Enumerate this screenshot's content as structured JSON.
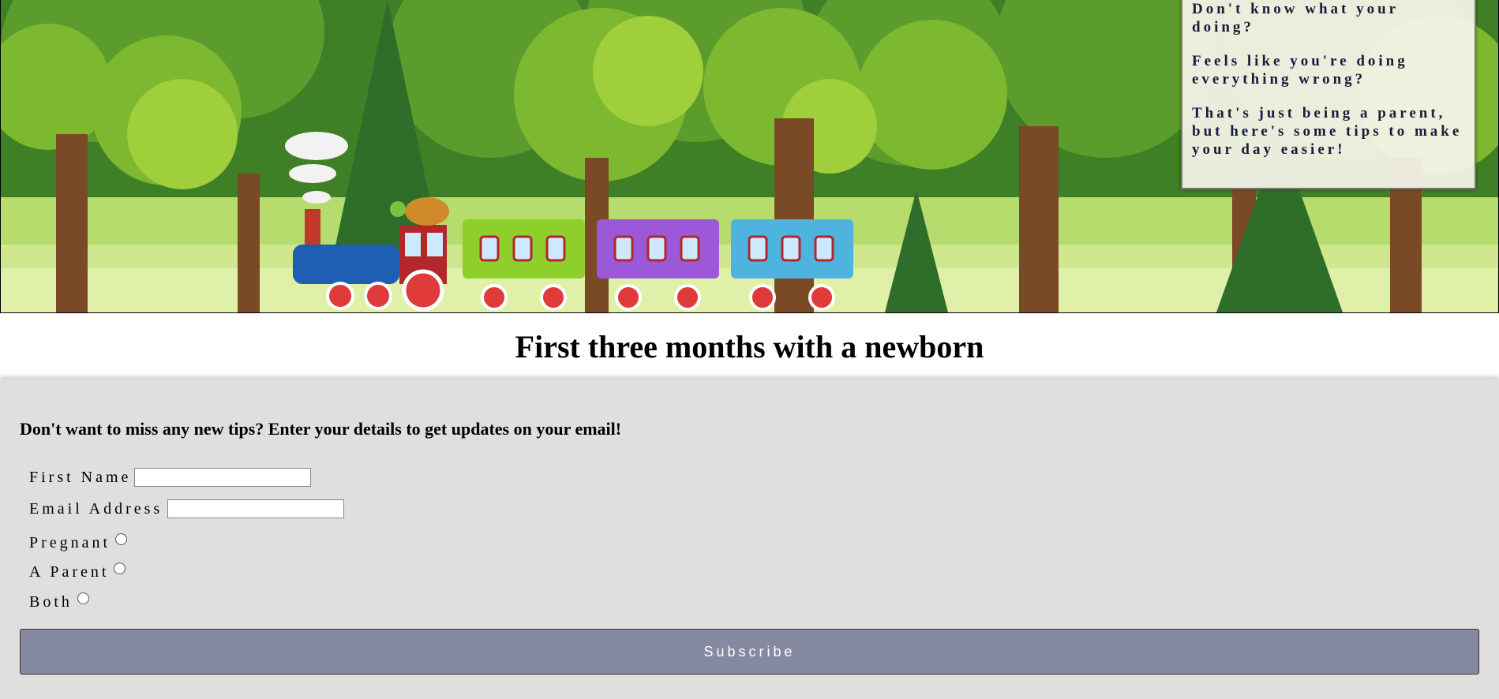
{
  "hero": {
    "tip_lines": [
      "Don't know what your doing?",
      "Feels like you're doing everything wrong?",
      "That's just being a parent, but here's some tips to make your day easier!"
    ]
  },
  "page": {
    "title": "First three months with a newborn"
  },
  "form": {
    "intro": "Don't want to miss any new tips? Enter your details to get updates on your email!",
    "first_name_label": "First Name",
    "first_name_value": "",
    "email_label": "Email Address",
    "email_value": "",
    "options": [
      "Pregnant",
      "A Parent",
      "Both"
    ],
    "subscribe_label": "Subscribe"
  },
  "colors": {
    "form_background": "#e1dede",
    "button": "#8689a2",
    "tip_text": "#1a1a3a"
  }
}
